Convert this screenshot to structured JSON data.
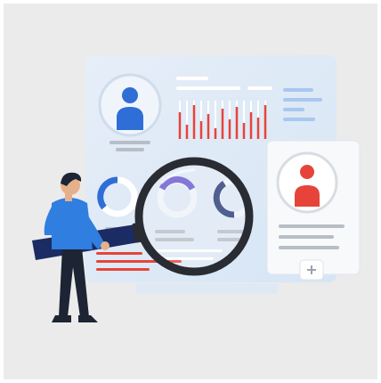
{
  "illustration": {
    "colors": {
      "background": "#ebebeb",
      "dashboard_panel": "#e2edf8",
      "card": "#f7f9fb",
      "accent_blue": "#2f6ed6",
      "accent_red": "#e6443a",
      "grey_line": "#b8bec6",
      "light_blue_line": "#a9c7ef",
      "lens_rim": "#2a2c33",
      "figure_shirt": "#2f7ee0",
      "figure_pants": "#1d2433",
      "handle": "#1b2b63"
    },
    "icons": [
      "user-avatar-icon",
      "plus-icon",
      "magnifying-glass-icon",
      "bar-chart-icon",
      "donut-chart-icon"
    ]
  }
}
